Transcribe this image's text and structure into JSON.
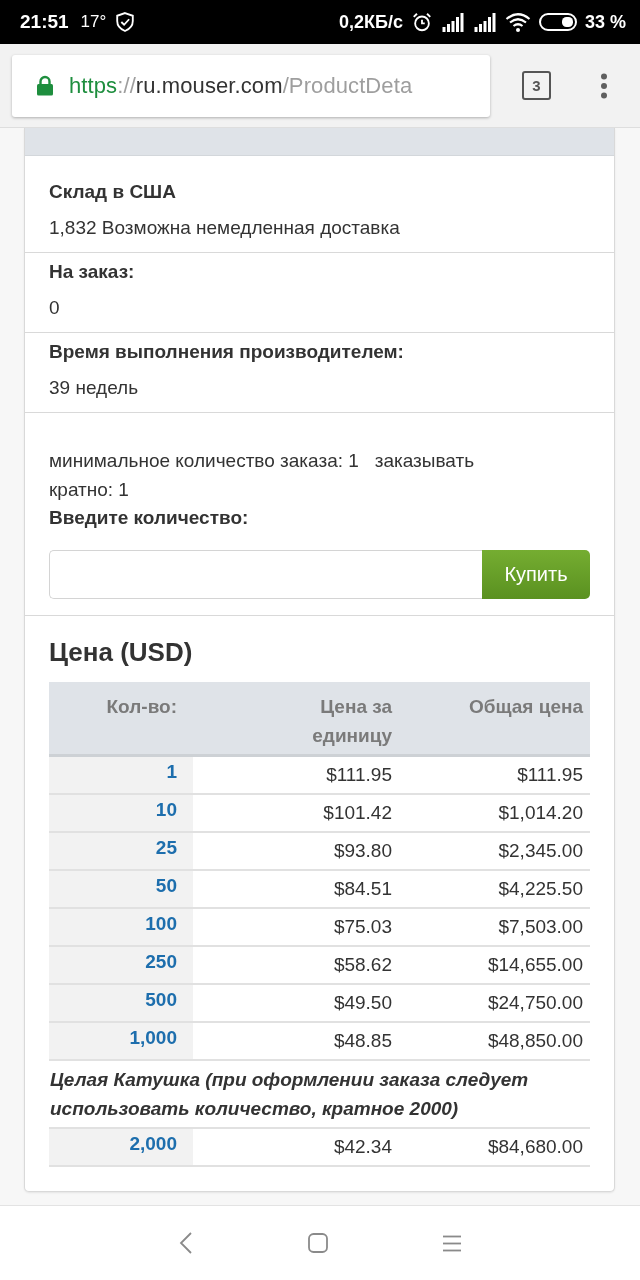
{
  "status_bar": {
    "time": "21:51",
    "temperature": "17°",
    "network_speed": "0,2КБ/с",
    "battery_percent": "33 %"
  },
  "browser": {
    "url": [
      {
        "kind": "scheme",
        "text": "https"
      },
      {
        "kind": "separator",
        "text": "://"
      },
      {
        "kind": "host",
        "text": "ru.mouser.com"
      },
      {
        "kind": "path",
        "text": "/ProductDeta"
      }
    ],
    "tab_count": "3"
  },
  "stock": [
    {
      "label": "Склад в США",
      "value": "1,832 Возможна немедленная доставка"
    },
    {
      "label": "На заказ:",
      "value": "0"
    },
    {
      "label": "Время выполнения производителем:",
      "value": "39 недель"
    }
  ],
  "order": {
    "terms": "минимальное количество заказа: 1   заказывать кратно: 1",
    "quantity_label": "Введите количество:",
    "buy_button": "Купить"
  },
  "pricing": {
    "title": "Цена (USD)",
    "columns": [
      "Кол-во:",
      "Цена за единицу",
      "Общая цена"
    ],
    "rows": [
      {
        "kind": "price",
        "quantity": "1",
        "unit_price": "$111.95",
        "total": "$111.95"
      },
      {
        "kind": "price",
        "quantity": "10",
        "unit_price": "$101.42",
        "total": "$1,014.20"
      },
      {
        "kind": "price",
        "quantity": "25",
        "unit_price": "$93.80",
        "total": "$2,345.00"
      },
      {
        "kind": "price",
        "quantity": "50",
        "unit_price": "$84.51",
        "total": "$4,225.50"
      },
      {
        "kind": "price",
        "quantity": "100",
        "unit_price": "$75.03",
        "total": "$7,503.00"
      },
      {
        "kind": "price",
        "quantity": "250",
        "unit_price": "$58.62",
        "total": "$14,655.00"
      },
      {
        "kind": "price",
        "quantity": "500",
        "unit_price": "$49.50",
        "total": "$24,750.00"
      },
      {
        "kind": "price",
        "quantity": "1,000",
        "unit_price": "$48.85",
        "total": "$48,850.00"
      },
      {
        "kind": "note",
        "text": "Целая Катушка (при оформлении заказа следует использовать количество, кратное 2000)"
      },
      {
        "kind": "price",
        "quantity": "2,000",
        "unit_price": "$42.34",
        "total": "$84,680.00"
      }
    ]
  }
}
